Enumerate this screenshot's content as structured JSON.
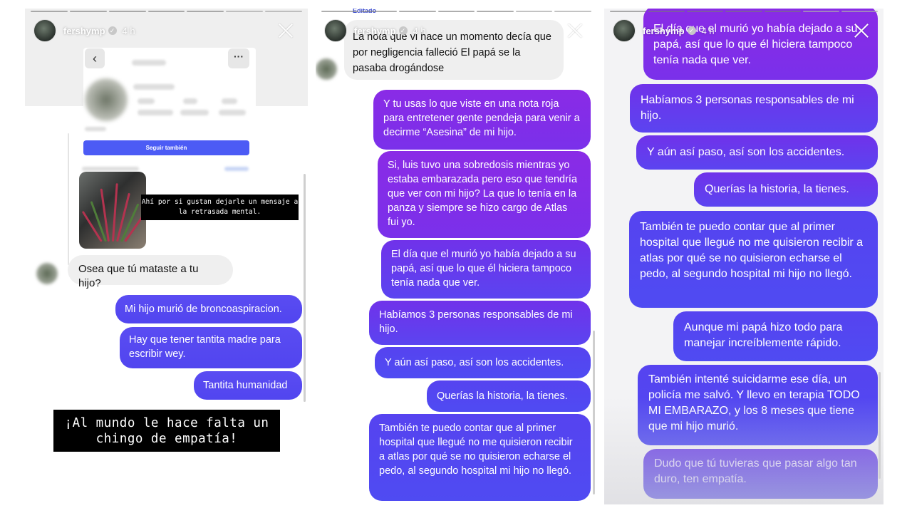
{
  "panels": [
    {
      "header": {
        "username": "fershymp",
        "time": "4 h"
      },
      "profile": {
        "follow_button": "Seguir también"
      },
      "caption_small": "Ahí por si gustan dejarle un mensaje a la retrasada mental.",
      "messages": [
        {
          "side": "received",
          "text": "Osea que tú mataste a tu hijo?"
        },
        {
          "side": "sent",
          "text": "Mi hijo murió de broncoaspiracion."
        },
        {
          "side": "sent",
          "text": "Hay que tener tantita madre para escribir wey."
        },
        {
          "side": "sent",
          "text": "Tantita humanidad"
        }
      ],
      "caption_big": "¡Al mundo le hace falta un chingo de empatía!"
    },
    {
      "header": {
        "username": "fershymp",
        "time": "4 h"
      },
      "top_tag": "Editado",
      "messages": [
        {
          "side": "received",
          "text": "La nota que vi hace un momento decía que por negligencia falleció El papá se la pasaba drogándose"
        },
        {
          "side": "sent",
          "text": "Y tu usas lo que viste en una nota roja para entretener gente pendeja para venir a decirme “Asesina” de mi hijo."
        },
        {
          "side": "sent",
          "text": "Si, luis tuvo una sobredosis mientras yo estaba embarazada pero eso que tendría que ver con mi hijo? La que lo tenía en la panza y siempre se hizo cargo de Atlas fui yo."
        },
        {
          "side": "sent",
          "text": "El día que el murió yo había dejado a su papá, así que lo que él hiciera tampoco tenía nada que ver."
        },
        {
          "side": "sent",
          "text": "Habíamos 3 personas responsables de mi hijo."
        },
        {
          "side": "sent",
          "text": "Y aún así paso, así son los accidentes."
        },
        {
          "side": "sent",
          "text": "Querías la historia, la tienes."
        },
        {
          "side": "sent",
          "text": "También te puedo contar que al primer hospital que llegué no me quisieron recibir a  atlas por qué se no quisieron echarse el pedo, al segundo hospital mi hijo no llegó."
        }
      ]
    },
    {
      "header": {
        "username": "fershymp",
        "time": "4 h"
      },
      "messages": [
        {
          "side": "sent",
          "text": "El día que el murió yo había dejado a su papá, así que lo que él hiciera tampoco tenía nada que ver."
        },
        {
          "side": "sent",
          "text": "Habíamos 3 personas responsables de mi hijo."
        },
        {
          "side": "sent",
          "text": "Y aún así paso, así son los accidentes."
        },
        {
          "side": "sent",
          "text": "Querías la historia, la tienes."
        },
        {
          "side": "sent",
          "text": "También te puedo contar que al primer hospital que llegué no me quisieron recibir a  atlas por qué se no quisieron echarse el pedo, al segundo hospital mi hijo no llegó."
        },
        {
          "side": "sent",
          "text": "Aunque mi papá hizo todo para manejar increíblemente rápido."
        },
        {
          "side": "sent",
          "text": "También intenté suicidarme ese día, un policía me salvó. Y llevo en terapia TODO MI EMBARAZO, y los 8 meses que tiene que mi hijo murió."
        },
        {
          "side": "sent",
          "text": "Dudo que tú tuvieras que pasar algo tan duro, ten empatía."
        }
      ]
    }
  ],
  "colors": {
    "sent_blue": "#5145ef",
    "sent_purple": "#8a2be6",
    "received_grey": "#efefef",
    "caption_bg": "#000000",
    "follow_blue": "#4c5bf5"
  },
  "icons": [
    "close-icon",
    "back-arrow-icon",
    "more-options-icon",
    "verified-badge-icon"
  ]
}
